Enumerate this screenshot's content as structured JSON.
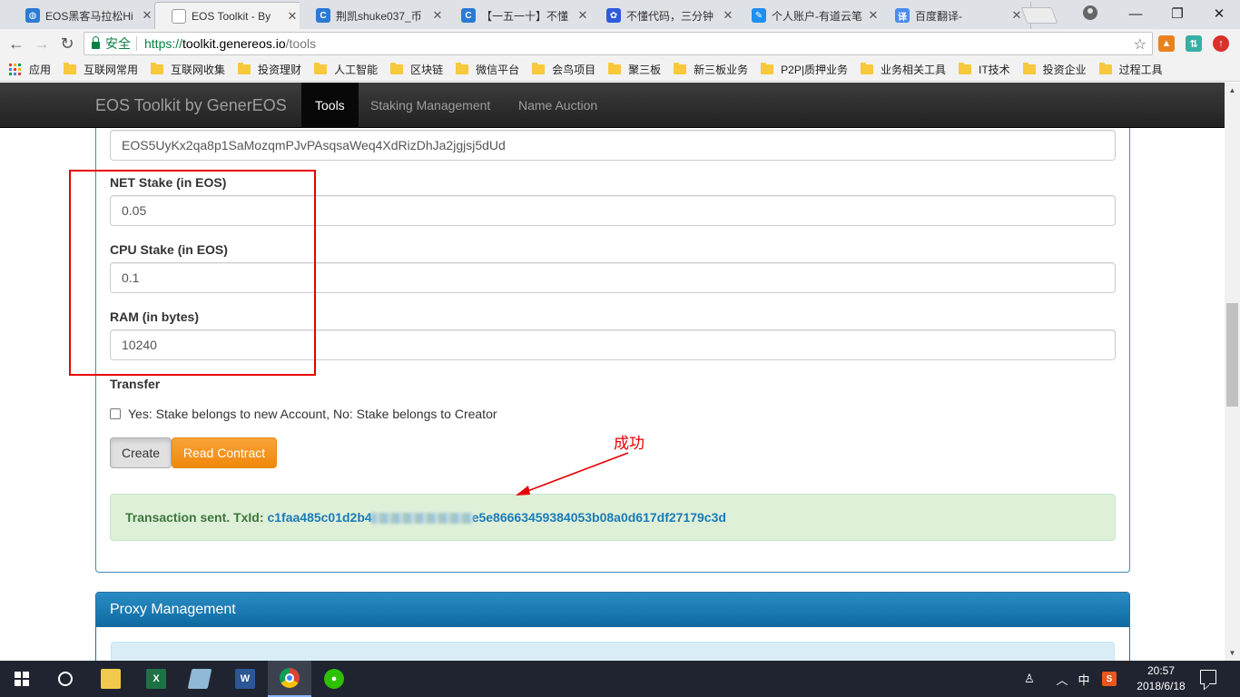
{
  "browser": {
    "tabs": [
      {
        "title": "EOS黑客马拉松Hi",
        "favicon": "globe-icon",
        "color": "#2b7ad6",
        "active": false
      },
      {
        "title": "EOS Toolkit - By",
        "favicon": "page-icon",
        "color": "#999999",
        "active": true
      },
      {
        "title": "荆凯shuke037_币",
        "favicon": "c-icon",
        "color": "#2b7ad6",
        "active": false
      },
      {
        "title": "【一五一十】不懂",
        "favicon": "c-icon",
        "color": "#2b7ad6",
        "active": false
      },
      {
        "title": "不懂代码，三分钟",
        "favicon": "paw-icon",
        "color": "#2e5bdb",
        "active": false
      },
      {
        "title": "个人账户-有道云笔",
        "favicon": "note-icon",
        "color": "#1f8ff0",
        "active": false
      },
      {
        "title": "百度翻译-",
        "favicon": "translate-icon",
        "color": "#4a8bf0",
        "active": false
      }
    ],
    "tab_close": "✕",
    "window_controls": {
      "minimize": "—",
      "restore": "❐",
      "close": "✕"
    },
    "nav": {
      "back": "←",
      "forward": "→",
      "reload": "↻"
    },
    "address": {
      "security_label": "安全",
      "url_scheme": "https://",
      "url_host": "toolkit.genereos.io",
      "url_path": "/tools"
    },
    "star": "☆",
    "bookmarks": {
      "apps_label": "应用",
      "items": [
        "互联网常用",
        "互联网收集",
        "投资理财",
        "人工智能",
        "区块链",
        "微信平台",
        "会鸟项目",
        "聚三板",
        "新三板业务",
        "P2P|质押业务",
        "业务相关工具",
        "IT技术",
        "投资企业",
        "过程工具"
      ]
    }
  },
  "site": {
    "brand": "EOS Toolkit by GenerEOS",
    "nav": [
      "Tools",
      "Staking Management",
      "Name Auction"
    ],
    "active_nav": "Tools"
  },
  "form": {
    "public_key_value": "EOS5UyKx2qa8p1SaMozqmPJvPAsqsaWeq4XdRizDhJa2jgjsj5dUd",
    "net_stake_label": "NET Stake (in EOS)",
    "net_stake_value": "0.05",
    "cpu_stake_label": "CPU Stake (in EOS)",
    "cpu_stake_value": "0.1",
    "ram_label": "RAM (in bytes)",
    "ram_value": "10240",
    "transfer_label": "Transfer",
    "transfer_checkbox_label": "Yes: Stake belongs to new Account, No: Stake belongs to Creator",
    "transfer_checked": false,
    "create_button": "Create",
    "read_contract_button": "Read Contract"
  },
  "alert": {
    "prefix": "Transaction sent. TxId:",
    "txid_start": "c1faa485c01d2b4",
    "txid_end": "e5e86663459384053b08a0d617df27179c3d"
  },
  "annotation": {
    "text": "成功",
    "color": "#e60000"
  },
  "proxy": {
    "title": "Proxy Management"
  },
  "taskbar": {
    "apps": [
      "start",
      "cortana",
      "file-explorer",
      "excel",
      "notepad",
      "word",
      "chrome",
      "wechat"
    ],
    "tray": {
      "ime": "中",
      "time": "20:57",
      "date": "2018/6/18"
    }
  },
  "colors": {
    "navbar": "#222222",
    "orange_button": "#f0880a",
    "success_bg": "#dff0d8",
    "success_text": "#3c763d",
    "txid": "#1a7bb9",
    "panel_header": "#1a76b0"
  }
}
